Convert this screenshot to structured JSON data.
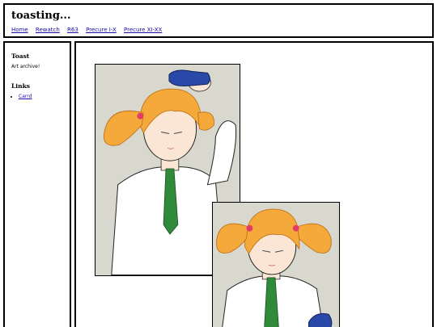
{
  "header": {
    "title": "toasting...",
    "nav": [
      "Home",
      "Rewatch",
      "R63",
      "Precure I-X",
      "Precure XI-XX"
    ]
  },
  "sidebar": {
    "heading": "Toast",
    "description": "Art archive!",
    "links_heading": "Links",
    "links": [
      "Carrd"
    ]
  },
  "colors": {
    "link": "#1a0dab",
    "art_background": "#d8d8cf",
    "hair": "#f4a93a",
    "tie": "#2f8a3a",
    "bottle": "#2948a8"
  },
  "gallery": {
    "images": [
      {
        "icon": "artwork-character-holding-bottle"
      },
      {
        "icon": "artwork-character-portrait"
      }
    ]
  }
}
